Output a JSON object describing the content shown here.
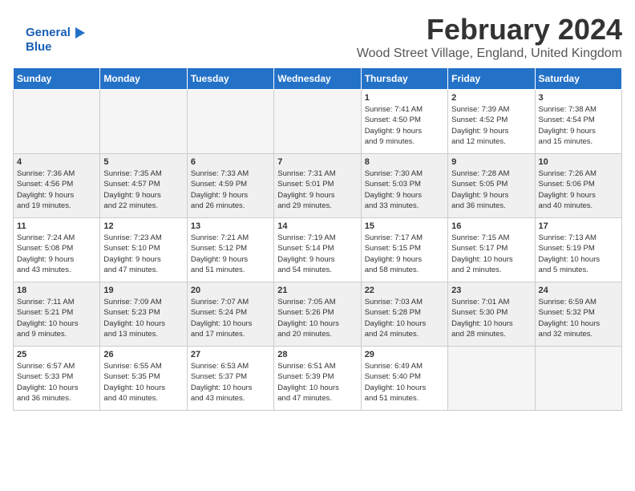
{
  "logo": {
    "line1": "General",
    "line2": "Blue"
  },
  "header": {
    "title": "February 2024",
    "subtitle": "Wood Street Village, England, United Kingdom"
  },
  "weekdays": [
    "Sunday",
    "Monday",
    "Tuesday",
    "Wednesday",
    "Thursday",
    "Friday",
    "Saturday"
  ],
  "weeks": [
    [
      {
        "day": "",
        "info": ""
      },
      {
        "day": "",
        "info": ""
      },
      {
        "day": "",
        "info": ""
      },
      {
        "day": "",
        "info": ""
      },
      {
        "day": "1",
        "info": "Sunrise: 7:41 AM\nSunset: 4:50 PM\nDaylight: 9 hours\nand 9 minutes."
      },
      {
        "day": "2",
        "info": "Sunrise: 7:39 AM\nSunset: 4:52 PM\nDaylight: 9 hours\nand 12 minutes."
      },
      {
        "day": "3",
        "info": "Sunrise: 7:38 AM\nSunset: 4:54 PM\nDaylight: 9 hours\nand 15 minutes."
      }
    ],
    [
      {
        "day": "4",
        "info": "Sunrise: 7:36 AM\nSunset: 4:56 PM\nDaylight: 9 hours\nand 19 minutes."
      },
      {
        "day": "5",
        "info": "Sunrise: 7:35 AM\nSunset: 4:57 PM\nDaylight: 9 hours\nand 22 minutes."
      },
      {
        "day": "6",
        "info": "Sunrise: 7:33 AM\nSunset: 4:59 PM\nDaylight: 9 hours\nand 26 minutes."
      },
      {
        "day": "7",
        "info": "Sunrise: 7:31 AM\nSunset: 5:01 PM\nDaylight: 9 hours\nand 29 minutes."
      },
      {
        "day": "8",
        "info": "Sunrise: 7:30 AM\nSunset: 5:03 PM\nDaylight: 9 hours\nand 33 minutes."
      },
      {
        "day": "9",
        "info": "Sunrise: 7:28 AM\nSunset: 5:05 PM\nDaylight: 9 hours\nand 36 minutes."
      },
      {
        "day": "10",
        "info": "Sunrise: 7:26 AM\nSunset: 5:06 PM\nDaylight: 9 hours\nand 40 minutes."
      }
    ],
    [
      {
        "day": "11",
        "info": "Sunrise: 7:24 AM\nSunset: 5:08 PM\nDaylight: 9 hours\nand 43 minutes."
      },
      {
        "day": "12",
        "info": "Sunrise: 7:23 AM\nSunset: 5:10 PM\nDaylight: 9 hours\nand 47 minutes."
      },
      {
        "day": "13",
        "info": "Sunrise: 7:21 AM\nSunset: 5:12 PM\nDaylight: 9 hours\nand 51 minutes."
      },
      {
        "day": "14",
        "info": "Sunrise: 7:19 AM\nSunset: 5:14 PM\nDaylight: 9 hours\nand 54 minutes."
      },
      {
        "day": "15",
        "info": "Sunrise: 7:17 AM\nSunset: 5:15 PM\nDaylight: 9 hours\nand 58 minutes."
      },
      {
        "day": "16",
        "info": "Sunrise: 7:15 AM\nSunset: 5:17 PM\nDaylight: 10 hours\nand 2 minutes."
      },
      {
        "day": "17",
        "info": "Sunrise: 7:13 AM\nSunset: 5:19 PM\nDaylight: 10 hours\nand 5 minutes."
      }
    ],
    [
      {
        "day": "18",
        "info": "Sunrise: 7:11 AM\nSunset: 5:21 PM\nDaylight: 10 hours\nand 9 minutes."
      },
      {
        "day": "19",
        "info": "Sunrise: 7:09 AM\nSunset: 5:23 PM\nDaylight: 10 hours\nand 13 minutes."
      },
      {
        "day": "20",
        "info": "Sunrise: 7:07 AM\nSunset: 5:24 PM\nDaylight: 10 hours\nand 17 minutes."
      },
      {
        "day": "21",
        "info": "Sunrise: 7:05 AM\nSunset: 5:26 PM\nDaylight: 10 hours\nand 20 minutes."
      },
      {
        "day": "22",
        "info": "Sunrise: 7:03 AM\nSunset: 5:28 PM\nDaylight: 10 hours\nand 24 minutes."
      },
      {
        "day": "23",
        "info": "Sunrise: 7:01 AM\nSunset: 5:30 PM\nDaylight: 10 hours\nand 28 minutes."
      },
      {
        "day": "24",
        "info": "Sunrise: 6:59 AM\nSunset: 5:32 PM\nDaylight: 10 hours\nand 32 minutes."
      }
    ],
    [
      {
        "day": "25",
        "info": "Sunrise: 6:57 AM\nSunset: 5:33 PM\nDaylight: 10 hours\nand 36 minutes."
      },
      {
        "day": "26",
        "info": "Sunrise: 6:55 AM\nSunset: 5:35 PM\nDaylight: 10 hours\nand 40 minutes."
      },
      {
        "day": "27",
        "info": "Sunrise: 6:53 AM\nSunset: 5:37 PM\nDaylight: 10 hours\nand 43 minutes."
      },
      {
        "day": "28",
        "info": "Sunrise: 6:51 AM\nSunset: 5:39 PM\nDaylight: 10 hours\nand 47 minutes."
      },
      {
        "day": "29",
        "info": "Sunrise: 6:49 AM\nSunset: 5:40 PM\nDaylight: 10 hours\nand 51 minutes."
      },
      {
        "day": "",
        "info": ""
      },
      {
        "day": "",
        "info": ""
      }
    ]
  ]
}
